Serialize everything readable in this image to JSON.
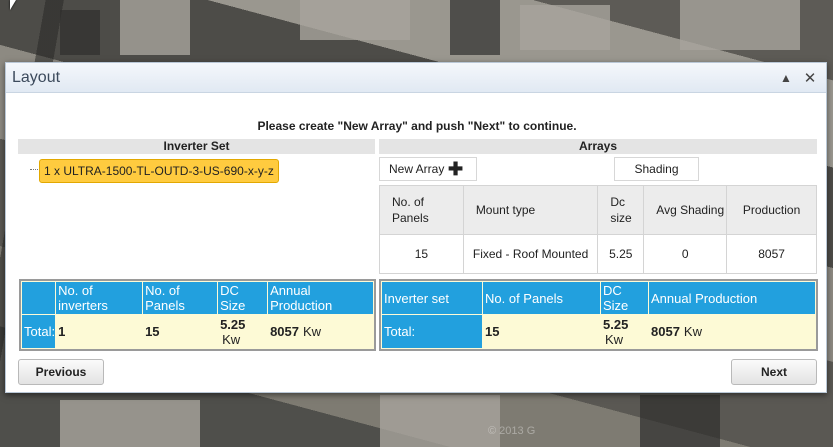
{
  "dialog": {
    "title": "Layout",
    "minimize_glyph": "▲",
    "close_glyph": "✕"
  },
  "instruction": "Please  create \"New Array\" and push \"Next\" to continue.",
  "inverter_set": {
    "header": "Inverter Set",
    "node_label": "1 x ULTRA-1500-TL-OUTD-3-US-690-x-y-z"
  },
  "arrays": {
    "header": "Arrays",
    "new_array_label": "New Array",
    "new_array_icon": "plus-icon",
    "shading_label": "Shading",
    "columns": [
      "No. of Panels",
      "Mount type",
      "Dc size",
      "Avg Shading",
      "Production"
    ],
    "rows": [
      {
        "panels": "15",
        "mount": "Fixed - Roof Mounted",
        "dc_size": "5.25",
        "avg_shading": "0",
        "production": "8057"
      }
    ]
  },
  "inverter_summary": {
    "columns": [
      "No. of inverters",
      "No. of Panels",
      "DC Size",
      "Annual Production"
    ],
    "total_label": "Total:",
    "inverters": "1",
    "panels": "15",
    "dc_size": "5.25",
    "dc_unit": "Kw",
    "production": "8057",
    "production_unit": "Kw"
  },
  "array_summary": {
    "columns": [
      "Inverter set",
      "No. of Panels",
      "DC Size",
      "Annual Production"
    ],
    "total_label": "Total:",
    "panels": "15",
    "dc_size": "5.25",
    "dc_unit": "Kw",
    "production": "8057",
    "production_unit": "Kw"
  },
  "footer": {
    "previous_label": "Previous",
    "next_label": "Next"
  },
  "background": {
    "watermark": "© 2013 G"
  },
  "colors": {
    "header_blue": "#22a0de",
    "total_row_bg": "#fdfad6",
    "inverter_node_bg": "#ffcb3f"
  }
}
